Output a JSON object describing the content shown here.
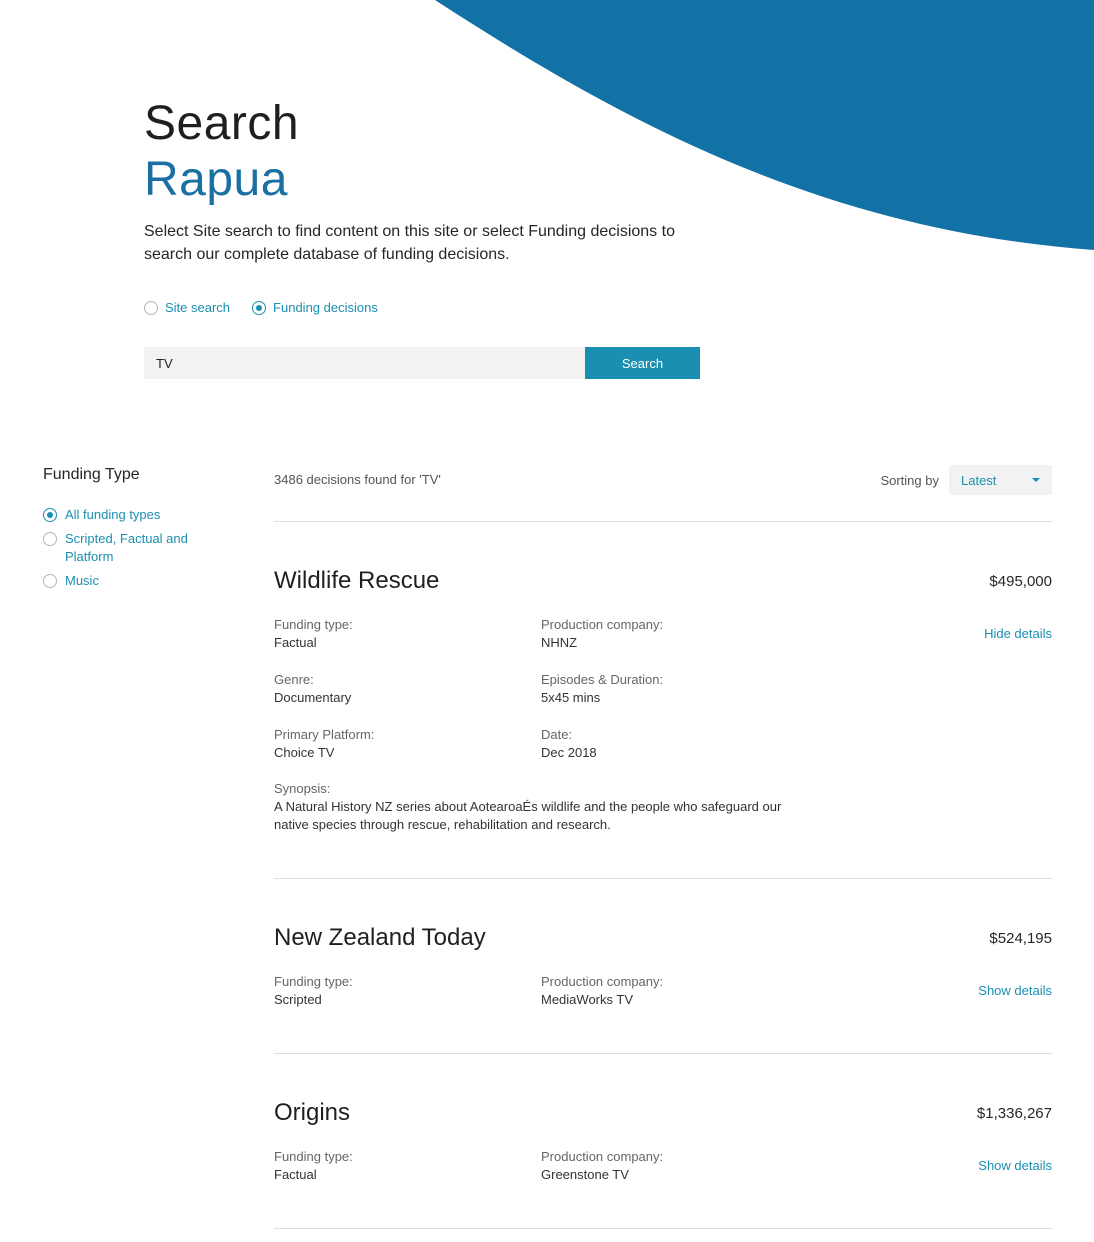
{
  "colors": {
    "accent": "#1b8fb1",
    "wave": "#1272a6",
    "subtitle": "#1a6fa3"
  },
  "header": {
    "title": "Search",
    "subtitle": "Rapua",
    "intro": "Select Site search to find content on this site or select Funding decisions to search our complete database of funding decisions."
  },
  "search": {
    "options": [
      {
        "label": "Site search",
        "selected": false
      },
      {
        "label": "Funding decisions",
        "selected": true
      }
    ],
    "query": "TV",
    "button_label": "Search"
  },
  "sidebar": {
    "title": "Funding Type",
    "filters": [
      {
        "label": "All funding types",
        "selected": true
      },
      {
        "label": "Scripted, Factual and Platform",
        "selected": false
      },
      {
        "label": "Music",
        "selected": false
      }
    ]
  },
  "results": {
    "count_text": "3486 decisions found for 'TV'",
    "sorting_label": "Sorting by",
    "sort_value": "Latest",
    "labels": {
      "funding_type": "Funding type:",
      "production_company": "Production company:",
      "genre": "Genre:",
      "episodes": "Episodes & Duration:",
      "platform": "Primary Platform:",
      "date": "Date:",
      "synopsis": "Synopsis:"
    },
    "items": [
      {
        "title": "Wildlife Rescue",
        "amount": "$495,000",
        "toggle": "Hide details",
        "funding_type": "Factual",
        "production_company": "NHNZ",
        "genre": "Documentary",
        "episodes": "5x45 mins",
        "platform": "Choice TV",
        "date": "Dec 2018",
        "synopsis": "A Natural History NZ series about AotearoaÉs wildlife and the people who safeguard our native species through rescue, rehabilitation and research."
      },
      {
        "title": "New Zealand Today",
        "amount": "$524,195",
        "toggle": "Show details",
        "funding_type": "Scripted",
        "production_company": "MediaWorks TV"
      },
      {
        "title": "Origins",
        "amount": "$1,336,267",
        "toggle": "Show details",
        "funding_type": "Factual",
        "production_company": "Greenstone TV"
      }
    ]
  }
}
